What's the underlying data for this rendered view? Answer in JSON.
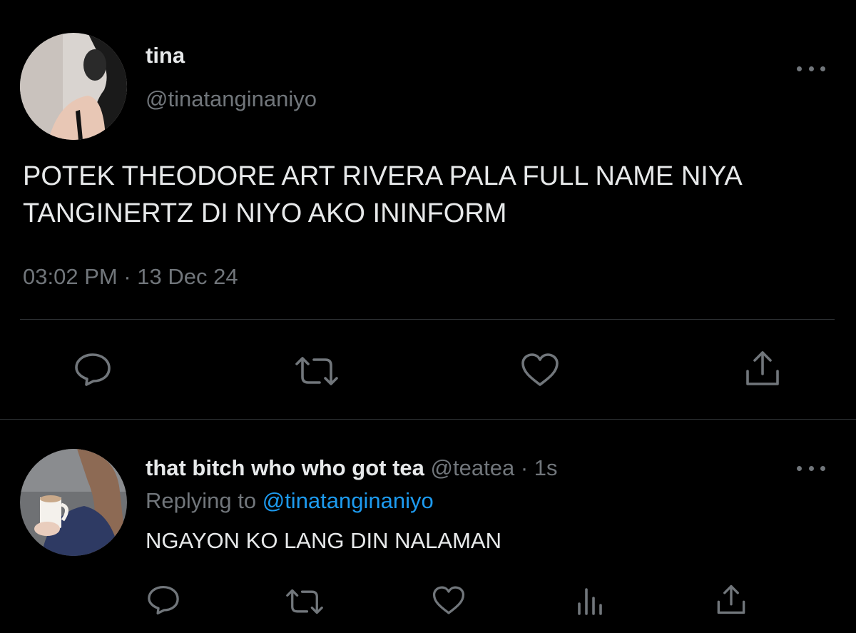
{
  "main_tweet": {
    "display_name": "tina",
    "handle": "@tinatanginaniyo",
    "text": "POTEK THEODORE ART RIVERA PALA FULL NAME NIYA\nTANGINERTZ DI NIYO AKO ININFORM",
    "time": "03:02 PM",
    "separator": "·",
    "date": "13 Dec 24",
    "actions": [
      "reply-icon",
      "retweet-icon",
      "like-icon",
      "share-icon"
    ]
  },
  "reply_tweet": {
    "display_name": "that bitch who who got tea",
    "handle": "@teatea",
    "separator": "·",
    "time_ago": "1s",
    "replying_prefix": "Replying to",
    "replying_handle": "@tinatanginaniyo",
    "text": "NGAYON KO LANG DIN NALAMAN",
    "actions": [
      "reply-icon",
      "retweet-icon",
      "like-icon",
      "analytics-icon",
      "share-icon"
    ]
  },
  "colors": {
    "background": "#000000",
    "primary_text": "#e7e9ea",
    "secondary_text": "#71767b",
    "link": "#1d9bf0",
    "divider": "#2f3336"
  }
}
